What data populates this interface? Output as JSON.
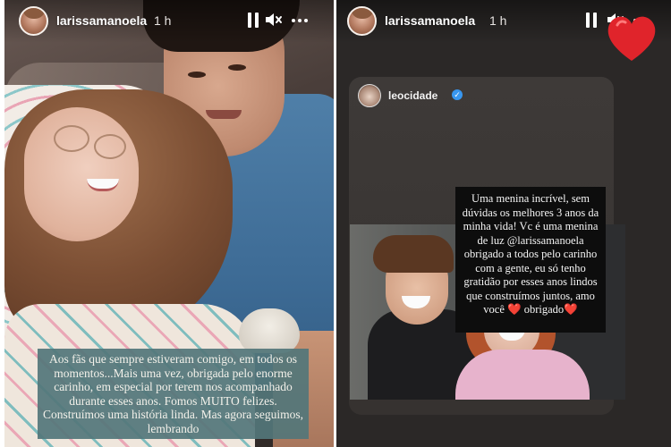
{
  "left_story": {
    "username": "larissamanoela",
    "time": "1 h",
    "caption": "Aos fãs que sempre estiveram comigo, em todos os momentos...Mais uma vez, obrigada pelo enorme carinho, em especial por terem nos acompanhado durante esses anos. Fomos MUITO felizes. Construímos uma história linda. Mas agora seguimos, lembrando"
  },
  "right_story": {
    "username": "larissamanoela",
    "time": "1 h",
    "sticker": "heart",
    "shared_post": {
      "username": "leocidade",
      "verified": true,
      "text": "Uma menina incrível, sem dúvidas os melhores 3 anos da minha vida! Vc é uma menina de luz @larissamanoela obrigado a todos pelo carinho com a gente, eu só tenho gratidão por esses anos lindos que construímos juntos, amo você ❤️ obrigado❤️"
    }
  },
  "icons": {
    "pause": "pause-icon",
    "mute": "mute-icon",
    "more": "more-icon",
    "verified": "verified-icon",
    "heart": "heart-icon"
  },
  "colors": {
    "caption_bg": "#52767a",
    "verified_blue": "#3897f0",
    "heart_red": "#e0242b"
  }
}
